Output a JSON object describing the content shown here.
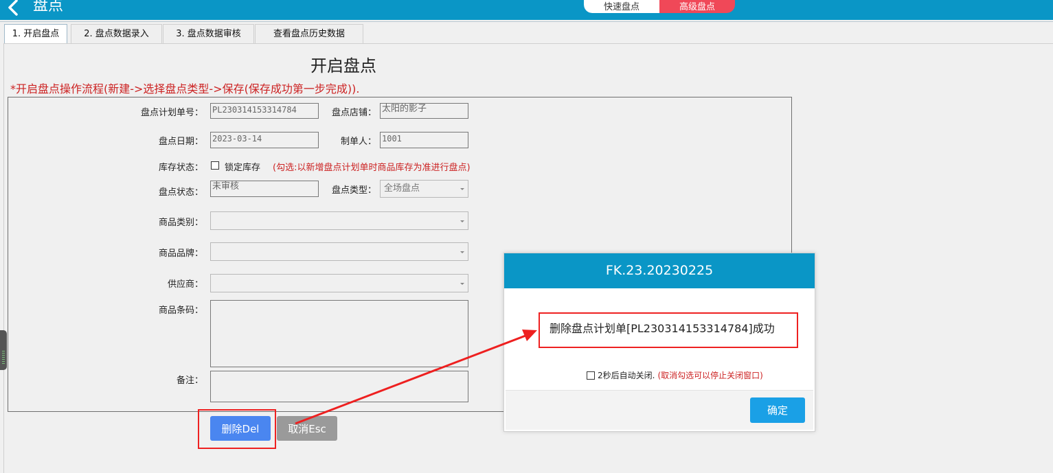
{
  "header": {
    "title": "盘点",
    "back_icon": "chevron-left-icon",
    "modes": {
      "quick": "快速盘点",
      "advanced": "高级盘点"
    },
    "colors": {
      "bar": "#0a96c6",
      "advanced": "#f04858"
    }
  },
  "tabs": [
    {
      "label": "1. 开启盘点"
    },
    {
      "label": "2. 盘点数据录入"
    },
    {
      "label": "3. 盘点数据审核"
    },
    {
      "label": "查看盘点历史数据"
    }
  ],
  "section": {
    "title": "开启盘点",
    "flow_note": "*开启盘点操作流程(新建->选择盘点类型->保存(保存成功第一步完成))."
  },
  "form": {
    "plan_no": {
      "label": "盘点计划单号：",
      "value": "PL230314153314784"
    },
    "store": {
      "label": "盘点店铺：",
      "value": "太阳的影子"
    },
    "date": {
      "label": "盘点日期：",
      "value": "2023-03-14"
    },
    "maker": {
      "label": "制单人：",
      "value": "1001"
    },
    "stock_state": {
      "label": "库存状态：",
      "checkbox_label": "锁定库存",
      "hint": "(勾选:以新增盘点计划单时商品库存为准进行盘点)",
      "checked": false
    },
    "status": {
      "label": "盘点状态：",
      "value": "未审核"
    },
    "type": {
      "label": "盘点类型：",
      "value": "全场盘点"
    },
    "category": {
      "label": "商品类别：",
      "value": ""
    },
    "brand": {
      "label": "商品品牌：",
      "value": ""
    },
    "supplier": {
      "label": "供应商：",
      "value": ""
    },
    "barcode": {
      "label": "商品条码：",
      "value": ""
    },
    "remark": {
      "label": "备注：",
      "value": ""
    }
  },
  "actions": {
    "delete": "删除Del",
    "cancel": "取消Esc"
  },
  "dialog": {
    "title": "FK.23.20230225",
    "message": "删除盘点计划单[PL230314153314784]成功",
    "auto_close_label": "2秒后自动关闭.",
    "auto_close_hint": "(取消勾选可以停止关闭窗口)",
    "auto_close_checked": false,
    "ok": "确定"
  }
}
